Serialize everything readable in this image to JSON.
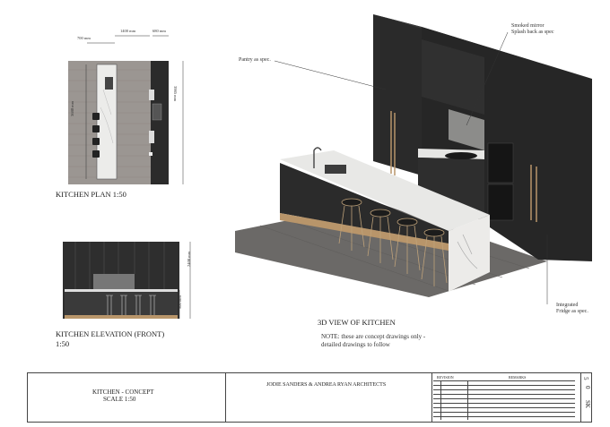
{
  "plan": {
    "title": "KITCHEN PLAN 1:50",
    "dims": {
      "w700": "700 mm",
      "w1400": "1400 mm",
      "w680": "680 mm",
      "h3680": "3680 mm",
      "h3985": "3985 mm"
    }
  },
  "elevation": {
    "title": "KITCHEN ELEVATION (FRONT)",
    "scale": "1:50",
    "dims": {
      "h2400": "2400 mm",
      "h900": "900 mm"
    }
  },
  "view3d": {
    "title": "3D VIEW OF KITCHEN",
    "note_line1": "NOTE: these are concept drawings only -",
    "note_line2": "detailed drawings to follow",
    "callouts": {
      "pantry": "Pantry as spec.",
      "mirror_line1": "Smoked mirror",
      "mirror_line2": "Splash back as spec",
      "fridge_line1": "Integrated",
      "fridge_line2": "Fridge as spec."
    }
  },
  "title_block": {
    "project_line1": "KITCHEN - CONCEPT",
    "project_line2": "SCALE 1:50",
    "architects": "JODIE SANDERS & ANDREA RYAN ARCHITECTS",
    "col_revision": "REVISION",
    "col_remarks": "REMARKS",
    "sheet_code": "SK",
    "sheet_number": "0",
    "sheet_sub": "5"
  },
  "colors": {
    "cabinet_dark": "#2b2b2b",
    "floor_grey": "#6e6c6a",
    "marble": "#e8e8e6",
    "brass": "#b8956a"
  }
}
